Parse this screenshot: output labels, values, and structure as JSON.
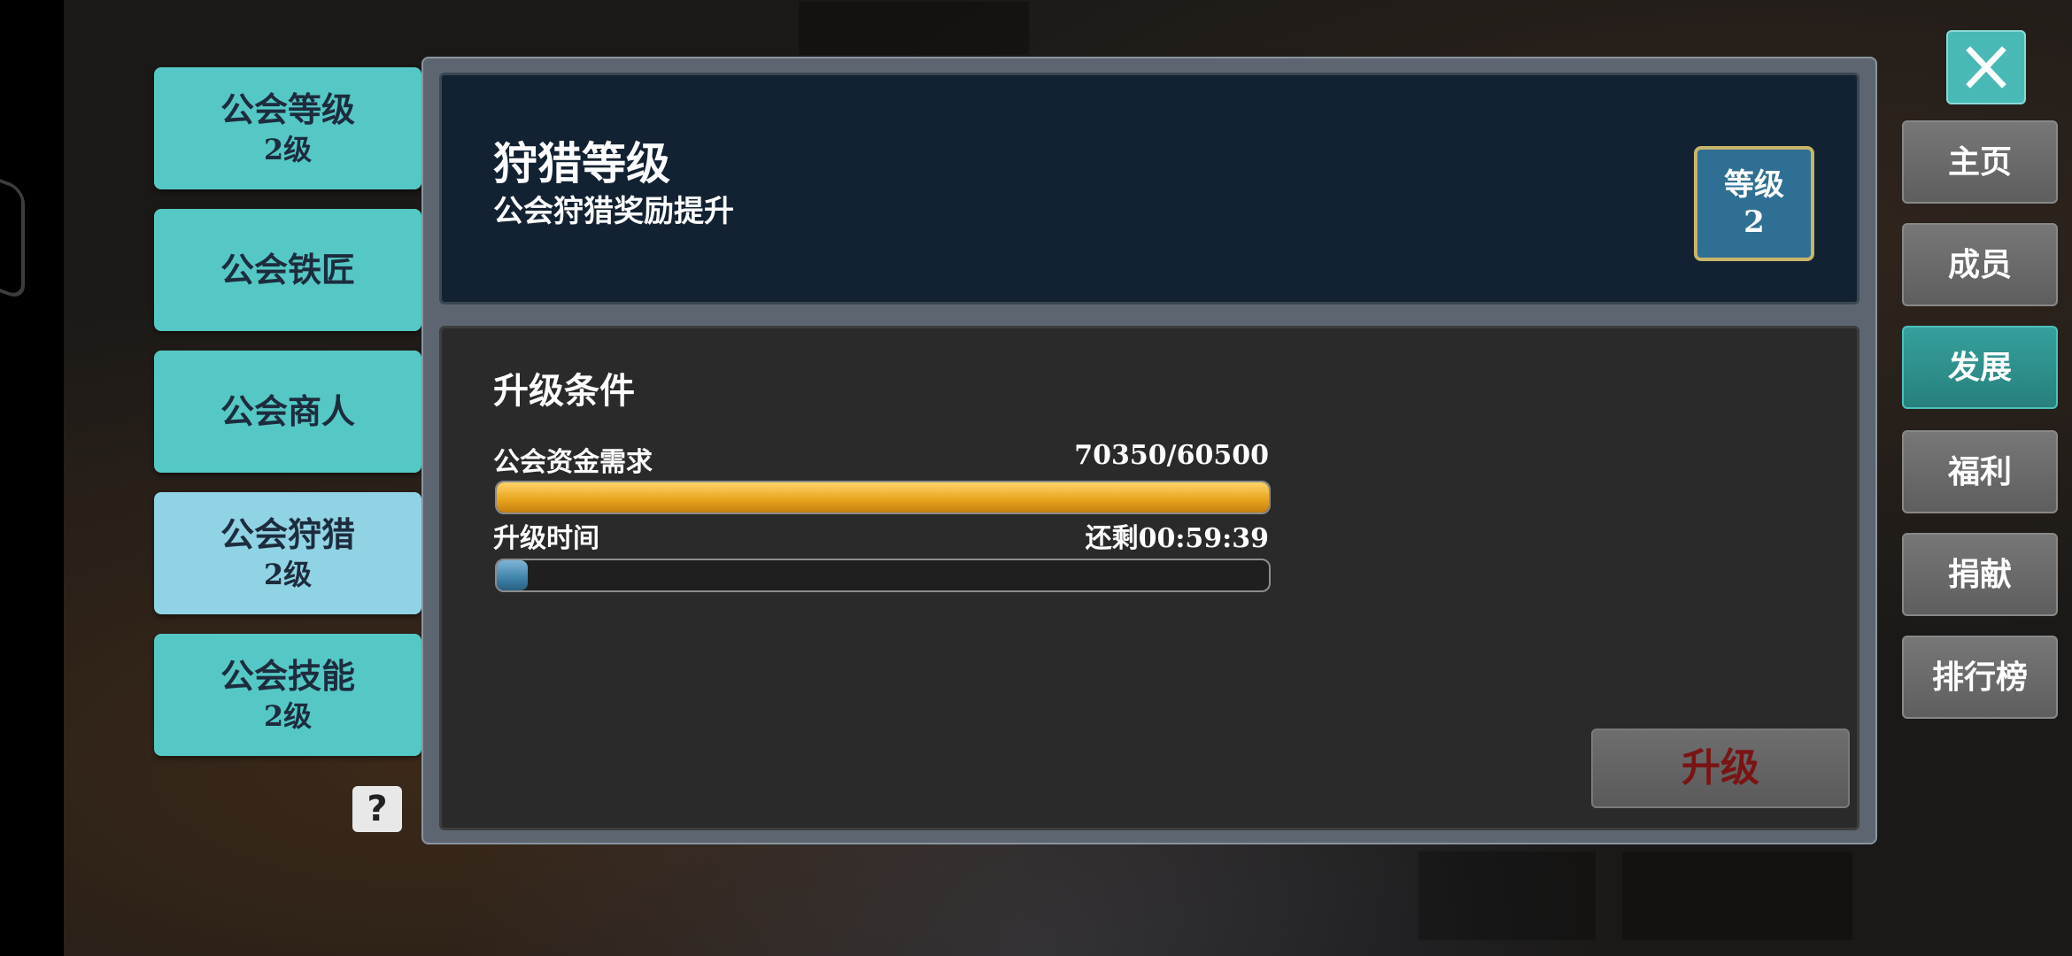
{
  "left_tabs": [
    {
      "label": "公会等级",
      "sub": "2级",
      "active": false
    },
    {
      "label": "公会铁匠",
      "sub": "",
      "active": false
    },
    {
      "label": "公会商人",
      "sub": "",
      "active": false
    },
    {
      "label": "公会狩猎",
      "sub": "2级",
      "active": true
    },
    {
      "label": "公会技能",
      "sub": "2级",
      "active": false
    }
  ],
  "help_icon": "question-mark-icon",
  "header": {
    "title": "狩猎等级",
    "subtitle": "公会狩猎奖励提升",
    "level_label": "等级",
    "level_value": "2"
  },
  "conditions": {
    "title": "升级条件",
    "funds": {
      "label": "公会资金需求",
      "value": "70350/60500",
      "progress": 1.0
    },
    "time": {
      "label": "升级时间",
      "value": "还剩00:59:39",
      "progress": 0.04
    },
    "upgrade_button": "升级"
  },
  "close_icon": "close-icon",
  "right_tabs": [
    {
      "label": "主页",
      "active": false
    },
    {
      "label": "成员",
      "active": false
    },
    {
      "label": "发展",
      "active": true
    },
    {
      "label": "福利",
      "active": false
    },
    {
      "label": "捐献",
      "active": false
    },
    {
      "label": "排行榜",
      "active": false
    }
  ],
  "colors": {
    "tab_teal": "#55c8c6",
    "tab_active": "#90d3e4",
    "header_bg": "#132232",
    "gold_bar": "#e7a21a",
    "blue_bar": "#3f82aa",
    "upgrade_text": "#7a1414",
    "right_active": "#35a09c"
  }
}
